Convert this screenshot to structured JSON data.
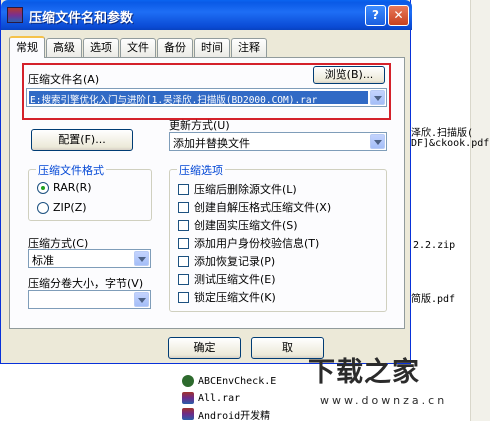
{
  "window": {
    "title": "压缩文件名和参数",
    "help_glyph": "?",
    "close_glyph": "✕"
  },
  "tabs": [
    "常规",
    "高级",
    "选项",
    "文件",
    "备份",
    "时间",
    "注释"
  ],
  "archive_name": {
    "label": "压缩文件名(A)",
    "browse_label": "浏览(B)...",
    "value": "E:搜索引擎优化入门与进阶[1.吴泽欣.扫描版(BD2000.COM).rar"
  },
  "update_mode": {
    "label": "更新方式(U)",
    "value": "添加并替换文件"
  },
  "profile_button": "配置(F)...",
  "archive_format": {
    "title": "压缩文件格式",
    "options": [
      {
        "label": "RAR(R)",
        "selected": true
      },
      {
        "label": "ZIP(Z)",
        "selected": false
      }
    ]
  },
  "compression_method": {
    "label": "压缩方式(C)",
    "value": "标准"
  },
  "split_volumes": {
    "label": "压缩分卷大小，字节(V)",
    "value": ""
  },
  "archive_options": {
    "title": "压缩选项",
    "items": [
      "压缩后删除源文件(L)",
      "创建自解压格式压缩文件(X)",
      "创建固实压缩文件(S)",
      "添加用户身份校验信息(T)",
      "添加恢复记录(P)",
      "测试压缩文件(E)",
      "锁定压缩文件(K)"
    ]
  },
  "footer": {
    "ok_label": "确定",
    "cancel_label": "取"
  },
  "background": {
    "lines": [
      "泽欣.扫描版(",
      "DF]&ckook.pdf",
      "2.2.zip",
      "简版.pdf"
    ],
    "files": [
      {
        "name": "ABCEnvCheck.E",
        "icon": "exe-icon"
      },
      {
        "name": "All.rar",
        "icon": "rar-icon"
      },
      {
        "name": "Android开发精",
        "icon": "rar-icon"
      }
    ]
  },
  "watermark": {
    "logo": "下载之家",
    "url": "www.downza.cn"
  },
  "colors": {
    "title_bar": "#0a5ae6",
    "dialog_bg": "#ece9d8",
    "highlight_border": "#d4212a",
    "selection": "#316ac5",
    "group_title": "#0046d5"
  }
}
